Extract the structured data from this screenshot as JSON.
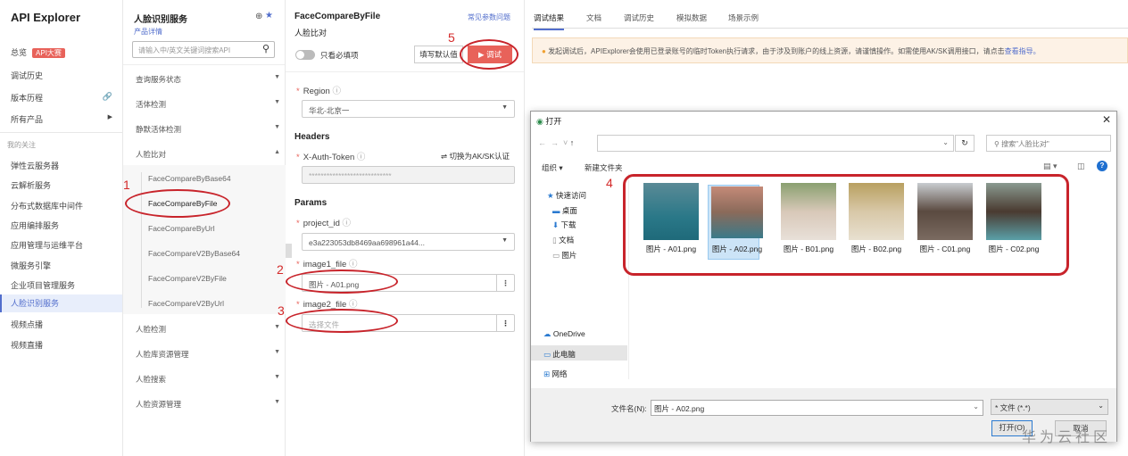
{
  "nav": {
    "title": "API Explorer",
    "items": [
      {
        "label": "总览",
        "badge": "API大赛"
      },
      {
        "label": "调试历史"
      },
      {
        "label": "版本历程"
      },
      {
        "label": "所有产品"
      }
    ],
    "section": "我的关注",
    "follows": [
      "弹性云服务器",
      "云解析服务",
      "分布式数据库中间件",
      "应用编排服务",
      "应用管理与运维平台",
      "微服务引擎",
      "企业项目管理服务",
      "人脸识别服务",
      "视频点播",
      "视频直播"
    ]
  },
  "service": {
    "title": "人脸识别服务",
    "detail_link": "产品详情",
    "search_placeholder": "请输入中/英文关键词搜索API",
    "groups_top": [
      "查询服务状态",
      "活体检测",
      "静默活体检测",
      "人脸比对"
    ],
    "sub_apis": [
      "FaceCompareByBase64",
      "FaceCompareByFile",
      "FaceCompareByUrl",
      "FaceCompareV2ByBase64",
      "FaceCompareV2ByFile",
      "FaceCompareV2ByUrl"
    ],
    "groups_bottom": [
      "人脸检测",
      "人脸库资源管理",
      "人脸搜索",
      "人脸资源管理"
    ]
  },
  "form": {
    "api_name": "FaceCompareByFile",
    "api_desc": "人脸比对",
    "faq_link": "常见参数问题",
    "required_toggle": "只看必填项",
    "fill_default": "填写默认值",
    "debug": "调试",
    "region_label": "Region",
    "region_value": "华北-北京一",
    "headers": "Headers",
    "token_label": "X-Auth-Token",
    "switch_auth": "切换为AK/SK认证",
    "token_value": "****************************",
    "params": "Params",
    "project_label": "project_id",
    "project_value": "e3a223053db8469aa698961a44...",
    "image1_label": "image1_file",
    "image1_value": "图片 - A01.png",
    "image2_label": "image2_file",
    "image2_placeholder": "选择文件"
  },
  "annotations": [
    "1",
    "2",
    "3",
    "4",
    "5"
  ],
  "result": {
    "tabs": [
      "调试结果",
      "文档",
      "调试历史",
      "模拟数据",
      "场景示例"
    ],
    "notice": "发起调试后，APIExplorer会使用已登录账号的临时Token执行请求，由于涉及到账户的线上资源，请谨慎操作。如需使用AK/SK调用接口，请点击",
    "notice_link": "查看指导。"
  },
  "dialog": {
    "title": "打开",
    "search_placeholder": "搜索\"人脸比对\"",
    "organize": "组织 ▾",
    "new_folder": "新建文件夹",
    "quick": [
      "快速访问",
      "桌面",
      "下载",
      "文档",
      "图片"
    ],
    "places": [
      "OneDrive",
      "此电脑",
      "网络"
    ],
    "files": [
      "图片 - A01.png",
      "图片 - A02.png",
      "图片 - B01.png",
      "图片 - B02.png",
      "图片 - C01.png",
      "图片 - C02.png"
    ],
    "filename_label": "文件名(N):",
    "filename_value": "图片 - A02.png",
    "filter": "* 文件 (*.*)",
    "open": "打开(O)",
    "cancel": "取消"
  },
  "watermark": "华为云社区"
}
